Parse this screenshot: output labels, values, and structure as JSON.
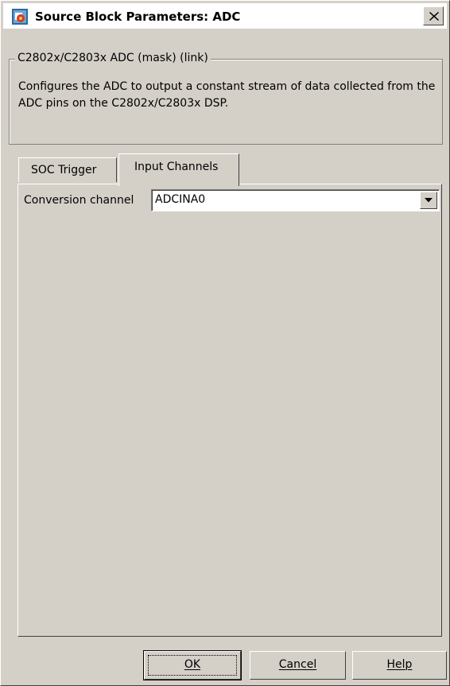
{
  "window": {
    "title": "Source Block Parameters: ADC",
    "close_label": "Close"
  },
  "group": {
    "legend": "C2802x/C2803x ADC (mask) (link)",
    "description": "Configures the ADC to output a constant stream of data collected from the ADC pins on the C2802x/C2803x DSP."
  },
  "tabs": [
    {
      "label": "SOC Trigger",
      "active": false
    },
    {
      "label": "Input Channels",
      "active": true
    }
  ],
  "form": {
    "conversion_channel_label": "Conversion channel",
    "conversion_channel_value": "ADCINA0"
  },
  "buttons": {
    "ok": "OK",
    "cancel": "Cancel",
    "help": "Help"
  },
  "colors": {
    "dialog_bg": "#d4d0c8",
    "titlebar_bg": "#ffffff"
  }
}
